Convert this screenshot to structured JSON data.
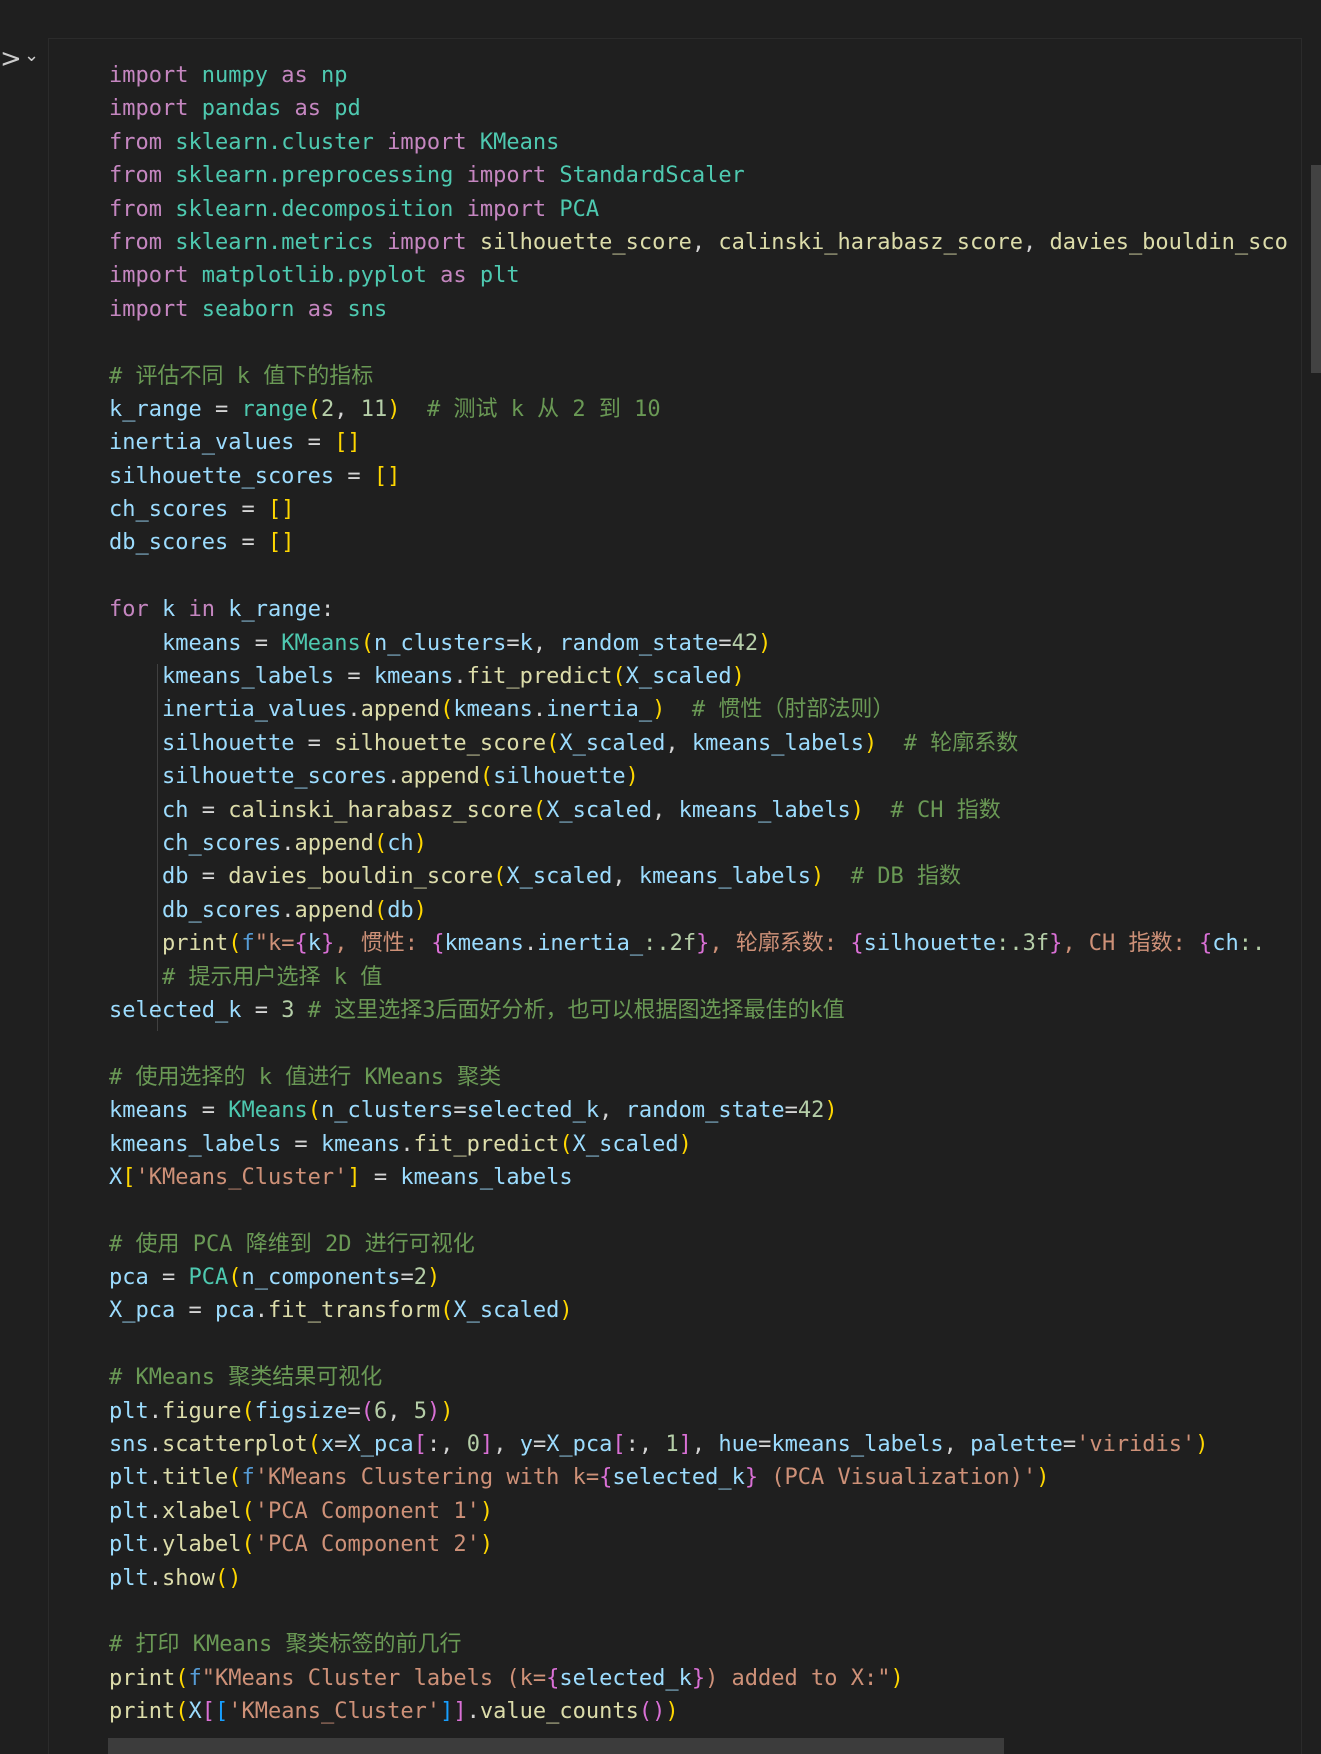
{
  "cell_controls": {
    "run_glyph": ">",
    "chevron_glyph": "⌄"
  },
  "code_lines": [
    [
      [
        "import",
        "k"
      ],
      [
        " ",
        "o"
      ],
      [
        "numpy",
        "m"
      ],
      [
        " ",
        "o"
      ],
      [
        "as",
        "k"
      ],
      [
        " ",
        "o"
      ],
      [
        "np",
        "m"
      ]
    ],
    [
      [
        "import",
        "k"
      ],
      [
        " ",
        "o"
      ],
      [
        "pandas",
        "m"
      ],
      [
        " ",
        "o"
      ],
      [
        "as",
        "k"
      ],
      [
        " ",
        "o"
      ],
      [
        "pd",
        "m"
      ]
    ],
    [
      [
        "from",
        "k"
      ],
      [
        " ",
        "o"
      ],
      [
        "sklearn.cluster",
        "m"
      ],
      [
        " ",
        "o"
      ],
      [
        "import",
        "k"
      ],
      [
        " ",
        "o"
      ],
      [
        "KMeans",
        "m"
      ]
    ],
    [
      [
        "from",
        "k"
      ],
      [
        " ",
        "o"
      ],
      [
        "sklearn.preprocessing",
        "m"
      ],
      [
        " ",
        "o"
      ],
      [
        "import",
        "k"
      ],
      [
        " ",
        "o"
      ],
      [
        "StandardScaler",
        "m"
      ]
    ],
    [
      [
        "from",
        "k"
      ],
      [
        " ",
        "o"
      ],
      [
        "sklearn.decomposition",
        "m"
      ],
      [
        " ",
        "o"
      ],
      [
        "import",
        "k"
      ],
      [
        " ",
        "o"
      ],
      [
        "PCA",
        "m"
      ]
    ],
    [
      [
        "from",
        "k"
      ],
      [
        " ",
        "o"
      ],
      [
        "sklearn.metrics",
        "m"
      ],
      [
        " ",
        "o"
      ],
      [
        "import",
        "k"
      ],
      [
        " ",
        "o"
      ],
      [
        "silhouette_score",
        "f"
      ],
      [
        ", ",
        "o"
      ],
      [
        "calinski_harabasz_score",
        "f"
      ],
      [
        ", ",
        "o"
      ],
      [
        "davies_bouldin_sco",
        "f"
      ]
    ],
    [
      [
        "import",
        "k"
      ],
      [
        " ",
        "o"
      ],
      [
        "matplotlib.pyplot",
        "m"
      ],
      [
        " ",
        "o"
      ],
      [
        "as",
        "k"
      ],
      [
        " ",
        "o"
      ],
      [
        "plt",
        "m"
      ]
    ],
    [
      [
        "import",
        "k"
      ],
      [
        " ",
        "o"
      ],
      [
        "seaborn",
        "m"
      ],
      [
        " ",
        "o"
      ],
      [
        "as",
        "k"
      ],
      [
        " ",
        "o"
      ],
      [
        "sns",
        "m"
      ]
    ],
    [],
    [
      [
        "# 评估不同 k 值下的指标",
        "c"
      ]
    ],
    [
      [
        "k_range",
        "v"
      ],
      [
        " = ",
        "o"
      ],
      [
        "range",
        "m"
      ],
      [
        "(",
        "b1"
      ],
      [
        "2",
        "n"
      ],
      [
        ", ",
        "o"
      ],
      [
        "11",
        "n"
      ],
      [
        ")",
        "b1"
      ],
      [
        "  ",
        "o"
      ],
      [
        "# 测试 k 从 2 到 10",
        "c"
      ]
    ],
    [
      [
        "inertia_values",
        "v"
      ],
      [
        " = ",
        "o"
      ],
      [
        "[]",
        "b1"
      ]
    ],
    [
      [
        "silhouette_scores",
        "v"
      ],
      [
        " = ",
        "o"
      ],
      [
        "[]",
        "b1"
      ]
    ],
    [
      [
        "ch_scores",
        "v"
      ],
      [
        " = ",
        "o"
      ],
      [
        "[]",
        "b1"
      ]
    ],
    [
      [
        "db_scores",
        "v"
      ],
      [
        " = ",
        "o"
      ],
      [
        "[]",
        "b1"
      ]
    ],
    [],
    [
      [
        "for",
        "k"
      ],
      [
        " ",
        "o"
      ],
      [
        "k",
        "v"
      ],
      [
        " ",
        "o"
      ],
      [
        "in",
        "k"
      ],
      [
        " ",
        "o"
      ],
      [
        "k_range",
        "v"
      ],
      [
        ":",
        "o"
      ]
    ],
    [
      [
        "    ",
        "o"
      ],
      [
        "kmeans",
        "v"
      ],
      [
        " = ",
        "o"
      ],
      [
        "KMeans",
        "m"
      ],
      [
        "(",
        "b1"
      ],
      [
        "n_clusters",
        "v"
      ],
      [
        "=",
        "o"
      ],
      [
        "k",
        "v"
      ],
      [
        ", ",
        "o"
      ],
      [
        "random_state",
        "v"
      ],
      [
        "=",
        "o"
      ],
      [
        "42",
        "n"
      ],
      [
        ")",
        "b1"
      ]
    ],
    [
      [
        "    ",
        "o"
      ],
      [
        "kmeans_labels",
        "v"
      ],
      [
        " = ",
        "o"
      ],
      [
        "kmeans",
        "v"
      ],
      [
        ".",
        "o"
      ],
      [
        "fit_predict",
        "f"
      ],
      [
        "(",
        "b1"
      ],
      [
        "X_scaled",
        "v"
      ],
      [
        ")",
        "b1"
      ]
    ],
    [
      [
        "    ",
        "o"
      ],
      [
        "inertia_values",
        "v"
      ],
      [
        ".",
        "o"
      ],
      [
        "append",
        "f"
      ],
      [
        "(",
        "b1"
      ],
      [
        "kmeans",
        "v"
      ],
      [
        ".",
        "o"
      ],
      [
        "inertia_",
        "v"
      ],
      [
        ")",
        "b1"
      ],
      [
        "  ",
        "o"
      ],
      [
        "# 惯性（肘部法则）",
        "c"
      ]
    ],
    [
      [
        "    ",
        "o"
      ],
      [
        "silhouette",
        "v"
      ],
      [
        " = ",
        "o"
      ],
      [
        "silhouette_score",
        "f"
      ],
      [
        "(",
        "b1"
      ],
      [
        "X_scaled",
        "v"
      ],
      [
        ", ",
        "o"
      ],
      [
        "kmeans_labels",
        "v"
      ],
      [
        ")",
        "b1"
      ],
      [
        "  ",
        "o"
      ],
      [
        "# 轮廓系数",
        "c"
      ]
    ],
    [
      [
        "    ",
        "o"
      ],
      [
        "silhouette_scores",
        "v"
      ],
      [
        ".",
        "o"
      ],
      [
        "append",
        "f"
      ],
      [
        "(",
        "b1"
      ],
      [
        "silhouette",
        "v"
      ],
      [
        ")",
        "b1"
      ]
    ],
    [
      [
        "    ",
        "o"
      ],
      [
        "ch",
        "v"
      ],
      [
        " = ",
        "o"
      ],
      [
        "calinski_harabasz_score",
        "f"
      ],
      [
        "(",
        "b1"
      ],
      [
        "X_scaled",
        "v"
      ],
      [
        ", ",
        "o"
      ],
      [
        "kmeans_labels",
        "v"
      ],
      [
        ")",
        "b1"
      ],
      [
        "  ",
        "o"
      ],
      [
        "# CH 指数",
        "c"
      ]
    ],
    [
      [
        "    ",
        "o"
      ],
      [
        "ch_scores",
        "v"
      ],
      [
        ".",
        "o"
      ],
      [
        "append",
        "f"
      ],
      [
        "(",
        "b1"
      ],
      [
        "ch",
        "v"
      ],
      [
        ")",
        "b1"
      ]
    ],
    [
      [
        "    ",
        "o"
      ],
      [
        "db",
        "v"
      ],
      [
        " = ",
        "o"
      ],
      [
        "davies_bouldin_score",
        "f"
      ],
      [
        "(",
        "b1"
      ],
      [
        "X_scaled",
        "v"
      ],
      [
        ", ",
        "o"
      ],
      [
        "kmeans_labels",
        "v"
      ],
      [
        ")",
        "b1"
      ],
      [
        "  ",
        "o"
      ],
      [
        "# DB 指数",
        "c"
      ]
    ],
    [
      [
        "    ",
        "o"
      ],
      [
        "db_scores",
        "v"
      ],
      [
        ".",
        "o"
      ],
      [
        "append",
        "f"
      ],
      [
        "(",
        "b1"
      ],
      [
        "db",
        "v"
      ],
      [
        ")",
        "b1"
      ]
    ],
    [
      [
        "    ",
        "o"
      ],
      [
        "print",
        "f"
      ],
      [
        "(",
        "b1"
      ],
      [
        "f",
        "blue"
      ],
      [
        "\"k=",
        "s"
      ],
      [
        "{",
        "b2"
      ],
      [
        "k",
        "v"
      ],
      [
        "}",
        "b2"
      ],
      [
        ", 惯性: ",
        "s"
      ],
      [
        "{",
        "b2"
      ],
      [
        "kmeans",
        "v"
      ],
      [
        ".",
        "o"
      ],
      [
        "inertia_",
        "v"
      ],
      [
        ":.2f",
        "n"
      ],
      [
        "}",
        "b2"
      ],
      [
        ", 轮廓系数: ",
        "s"
      ],
      [
        "{",
        "b2"
      ],
      [
        "silhouette",
        "v"
      ],
      [
        ":.3f",
        "n"
      ],
      [
        "}",
        "b2"
      ],
      [
        ", CH 指数: ",
        "s"
      ],
      [
        "{",
        "b2"
      ],
      [
        "ch",
        "v"
      ],
      [
        ":.",
        "n"
      ]
    ],
    [
      [
        "    ",
        "o"
      ],
      [
        "# 提示用户选择 k 值",
        "c"
      ]
    ],
    [
      [
        "selected_k",
        "v"
      ],
      [
        " = ",
        "o"
      ],
      [
        "3",
        "n"
      ],
      [
        " ",
        "o"
      ],
      [
        "# 这里选择3后面好分析，也可以根据图选择最佳的k值",
        "c"
      ]
    ],
    [],
    [
      [
        "# 使用选择的 k 值进行 KMeans 聚类",
        "c"
      ]
    ],
    [
      [
        "kmeans",
        "v"
      ],
      [
        " = ",
        "o"
      ],
      [
        "KMeans",
        "m"
      ],
      [
        "(",
        "b1"
      ],
      [
        "n_clusters",
        "v"
      ],
      [
        "=",
        "o"
      ],
      [
        "selected_k",
        "v"
      ],
      [
        ", ",
        "o"
      ],
      [
        "random_state",
        "v"
      ],
      [
        "=",
        "o"
      ],
      [
        "42",
        "n"
      ],
      [
        ")",
        "b1"
      ]
    ],
    [
      [
        "kmeans_labels",
        "v"
      ],
      [
        " = ",
        "o"
      ],
      [
        "kmeans",
        "v"
      ],
      [
        ".",
        "o"
      ],
      [
        "fit_predict",
        "f"
      ],
      [
        "(",
        "b1"
      ],
      [
        "X_scaled",
        "v"
      ],
      [
        ")",
        "b1"
      ]
    ],
    [
      [
        "X",
        "v"
      ],
      [
        "[",
        "b1"
      ],
      [
        "'KMeans_Cluster'",
        "s"
      ],
      [
        "]",
        "b1"
      ],
      [
        " = ",
        "o"
      ],
      [
        "kmeans_labels",
        "v"
      ]
    ],
    [],
    [
      [
        "# 使用 PCA 降维到 2D 进行可视化",
        "c"
      ]
    ],
    [
      [
        "pca",
        "v"
      ],
      [
        " = ",
        "o"
      ],
      [
        "PCA",
        "m"
      ],
      [
        "(",
        "b1"
      ],
      [
        "n_components",
        "v"
      ],
      [
        "=",
        "o"
      ],
      [
        "2",
        "n"
      ],
      [
        ")",
        "b1"
      ]
    ],
    [
      [
        "X_pca",
        "v"
      ],
      [
        " = ",
        "o"
      ],
      [
        "pca",
        "v"
      ],
      [
        ".",
        "o"
      ],
      [
        "fit_transform",
        "f"
      ],
      [
        "(",
        "b1"
      ],
      [
        "X_scaled",
        "v"
      ],
      [
        ")",
        "b1"
      ]
    ],
    [],
    [
      [
        "# KMeans 聚类结果可视化",
        "c"
      ]
    ],
    [
      [
        "plt",
        "v"
      ],
      [
        ".",
        "o"
      ],
      [
        "figure",
        "f"
      ],
      [
        "(",
        "b1"
      ],
      [
        "figsize",
        "v"
      ],
      [
        "=",
        "o"
      ],
      [
        "(",
        "b2"
      ],
      [
        "6",
        "n"
      ],
      [
        ", ",
        "o"
      ],
      [
        "5",
        "n"
      ],
      [
        ")",
        "b2"
      ],
      [
        ")",
        "b1"
      ]
    ],
    [
      [
        "sns",
        "v"
      ],
      [
        ".",
        "o"
      ],
      [
        "scatterplot",
        "f"
      ],
      [
        "(",
        "b1"
      ],
      [
        "x",
        "v"
      ],
      [
        "=",
        "o"
      ],
      [
        "X_pca",
        "v"
      ],
      [
        "[",
        "b2"
      ],
      [
        ":, ",
        "o"
      ],
      [
        "0",
        "n"
      ],
      [
        "]",
        "b2"
      ],
      [
        ", ",
        "o"
      ],
      [
        "y",
        "v"
      ],
      [
        "=",
        "o"
      ],
      [
        "X_pca",
        "v"
      ],
      [
        "[",
        "b2"
      ],
      [
        ":, ",
        "o"
      ],
      [
        "1",
        "n"
      ],
      [
        "]",
        "b2"
      ],
      [
        ", ",
        "o"
      ],
      [
        "hue",
        "v"
      ],
      [
        "=",
        "o"
      ],
      [
        "kmeans_labels",
        "v"
      ],
      [
        ", ",
        "o"
      ],
      [
        "palette",
        "v"
      ],
      [
        "=",
        "o"
      ],
      [
        "'viridis'",
        "s"
      ],
      [
        ")",
        "b1"
      ]
    ],
    [
      [
        "plt",
        "v"
      ],
      [
        ".",
        "o"
      ],
      [
        "title",
        "f"
      ],
      [
        "(",
        "b1"
      ],
      [
        "f",
        "blue"
      ],
      [
        "'KMeans Clustering with k=",
        "s"
      ],
      [
        "{",
        "b2"
      ],
      [
        "selected_k",
        "v"
      ],
      [
        "}",
        "b2"
      ],
      [
        " (PCA Visualization)'",
        "s"
      ],
      [
        ")",
        "b1"
      ]
    ],
    [
      [
        "plt",
        "v"
      ],
      [
        ".",
        "o"
      ],
      [
        "xlabel",
        "f"
      ],
      [
        "(",
        "b1"
      ],
      [
        "'PCA Component 1'",
        "s"
      ],
      [
        ")",
        "b1"
      ]
    ],
    [
      [
        "plt",
        "v"
      ],
      [
        ".",
        "o"
      ],
      [
        "ylabel",
        "f"
      ],
      [
        "(",
        "b1"
      ],
      [
        "'PCA Component 2'",
        "s"
      ],
      [
        ")",
        "b1"
      ]
    ],
    [
      [
        "plt",
        "v"
      ],
      [
        ".",
        "o"
      ],
      [
        "show",
        "f"
      ],
      [
        "(",
        "b1"
      ],
      [
        ")",
        "b1"
      ]
    ],
    [],
    [
      [
        "# 打印 KMeans 聚类标签的前几行",
        "c"
      ]
    ],
    [
      [
        "print",
        "f"
      ],
      [
        "(",
        "b1"
      ],
      [
        "f",
        "blue"
      ],
      [
        "\"KMeans Cluster labels (k=",
        "s"
      ],
      [
        "{",
        "b2"
      ],
      [
        "selected_k",
        "v"
      ],
      [
        "}",
        "b2"
      ],
      [
        ") added to X:\"",
        "s"
      ],
      [
        ")",
        "b1"
      ]
    ],
    [
      [
        "print",
        "f"
      ],
      [
        "(",
        "b1"
      ],
      [
        "X",
        "v"
      ],
      [
        "[",
        "b2"
      ],
      [
        "[",
        "b3"
      ],
      [
        "'KMeans_Cluster'",
        "s"
      ],
      [
        "]",
        "b3"
      ],
      [
        "]",
        "b2"
      ],
      [
        ".",
        "o"
      ],
      [
        "value_counts",
        "f"
      ],
      [
        "(",
        "b2"
      ],
      [
        ")",
        "b2"
      ],
      [
        ")",
        "b1"
      ]
    ]
  ]
}
